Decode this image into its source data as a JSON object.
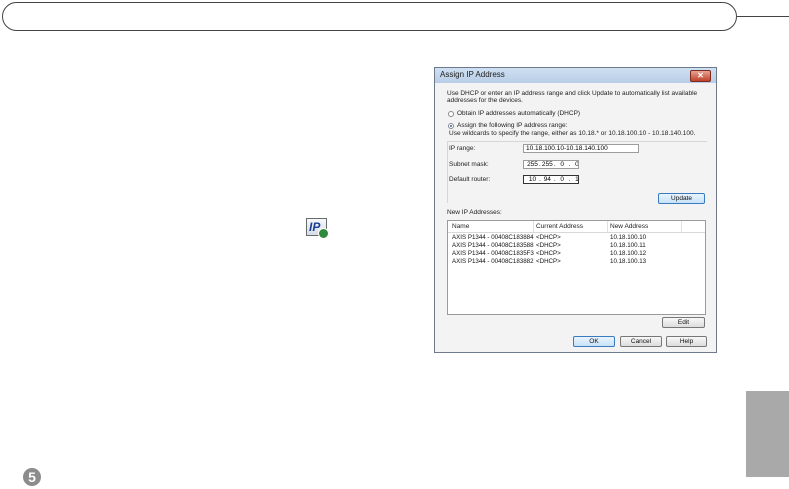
{
  "dialog": {
    "title": "Assign IP Address",
    "close_glyph": "✕",
    "instructions_line1": "Use DHCP or enter an IP address range and click Update to automatically list available",
    "instructions_line2": "addresses for the devices.",
    "option_dhcp_label": "Obtain IP addresses automatically (DHCP)",
    "option_range_label": "Assign the following IP address range:",
    "selected_option": "range",
    "wildcard_hint": "Use wildcards to specify the range, either as 10.18.* or 10.18.100.10 - 10.18.140.100.",
    "ip_range_label": "IP range:",
    "ip_range_value": "10.18.100.10-10.18.140.100",
    "subnet_mask_label": "Subnet mask:",
    "subnet_mask_octets": [
      "255",
      "255",
      "0",
      "0"
    ],
    "default_router_label": "Default router:",
    "default_router_octets": [
      "10",
      "94",
      "0",
      "1"
    ],
    "update_button": "Update",
    "new_ip_label": "New IP Addresses:",
    "columns": [
      "Name",
      "Current Address",
      "New Address"
    ],
    "rows": [
      {
        "name": "AXIS P1344 - 00408C183884",
        "current": "<DHCP>",
        "new": "10.18.100.10"
      },
      {
        "name": "AXIS P1344 - 00408C183588",
        "current": "<DHCP>",
        "new": "10.18.100.11"
      },
      {
        "name": "AXIS P1344 - 00408C1835F3",
        "current": "<DHCP>",
        "new": "10.18.100.12"
      },
      {
        "name": "AXIS P1344 - 00408C183882",
        "current": "<DHCP>",
        "new": "10.18.100.13"
      }
    ],
    "edit_button": "Edit",
    "ok_button": "OK",
    "cancel_button": "Cancel",
    "help_button": "Help"
  },
  "ip_icon": {
    "icon": "ip-address-icon",
    "text": "IP"
  },
  "page_number": "5",
  "colors": {
    "side_tab": "#a9a9a9",
    "page_badge": "#8c8c8c",
    "title_bar": "#b8cde6"
  }
}
